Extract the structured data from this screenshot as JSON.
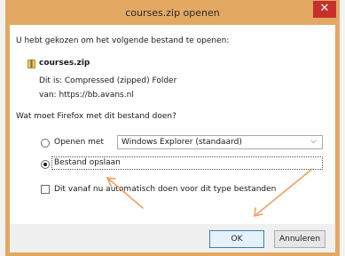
{
  "window": {
    "title": "courses.zip openen",
    "close_glyph": "✕"
  },
  "intro": "U hebt gekozen om het volgende bestand te openen:",
  "file": {
    "icon": "zip-file-icon",
    "name": "courses.zip",
    "type_line": "Dit is: Compressed (zipped) Folder",
    "source_line": "van: https://bb.avans.nl"
  },
  "question": "Wat moet Firefox met dit bestand doen?",
  "options": {
    "open_with_label": "Openen met",
    "open_with_app": "Windows Explorer (standaard)",
    "open_with_selected": false,
    "save_label": "Bestand opslaan",
    "save_selected": true
  },
  "auto_checkbox": {
    "label": "Dit vanaf nu automatisch doen voor dit type bestanden",
    "checked": false
  },
  "buttons": {
    "ok": "OK",
    "cancel": "Annuleren"
  },
  "colors": {
    "frame": "#e3a862",
    "close": "#c7302a",
    "annotation_arrow": "#f0a060"
  }
}
